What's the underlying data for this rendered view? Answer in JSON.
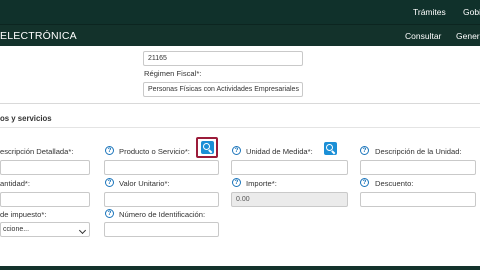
{
  "topbar": {
    "tramites": "Trámites",
    "gobierno": "Gobierno"
  },
  "navbar": {
    "brand": "ELECTRÓNICA",
    "consultar": "Consultar",
    "generar": "Generar"
  },
  "emisor": {
    "code_value": "21165",
    "regimen_label": "Régimen Fiscal*:",
    "regimen_value": "Personas Físicas con Actividades Empresariales"
  },
  "section": {
    "title": "os y servicios"
  },
  "fields": {
    "descripcion_detallada": {
      "label": "escripción Detallada*:",
      "value": ""
    },
    "producto_servicio": {
      "label": "Producto o Servicio*:",
      "value": ""
    },
    "unidad_medida": {
      "label": "Unidad de Medida*:",
      "value": ""
    },
    "descripcion_unidad": {
      "label": "Descripción de la Unidad:",
      "value": ""
    },
    "cantidad": {
      "label": "antidad*:",
      "value": ""
    },
    "valor_unitario": {
      "label": "Valor Unitario*:",
      "value": ""
    },
    "importe": {
      "label": "Importe*:",
      "value": "0.00"
    },
    "descuento": {
      "label": "Descuento:",
      "value": ""
    },
    "objeto_impuesto": {
      "label": "de impuesto*:",
      "value": "ccione..."
    },
    "numero_identificacion": {
      "label": "Número de Identificación:",
      "value": ""
    }
  },
  "icons": {
    "help": "question-circle-icon",
    "search": "search-icon",
    "dropdown": "chevron-down-icon"
  },
  "colors": {
    "header_bg": "#10312b",
    "accent_blue": "#1b8fd6",
    "highlight": "#9b1c3a"
  }
}
